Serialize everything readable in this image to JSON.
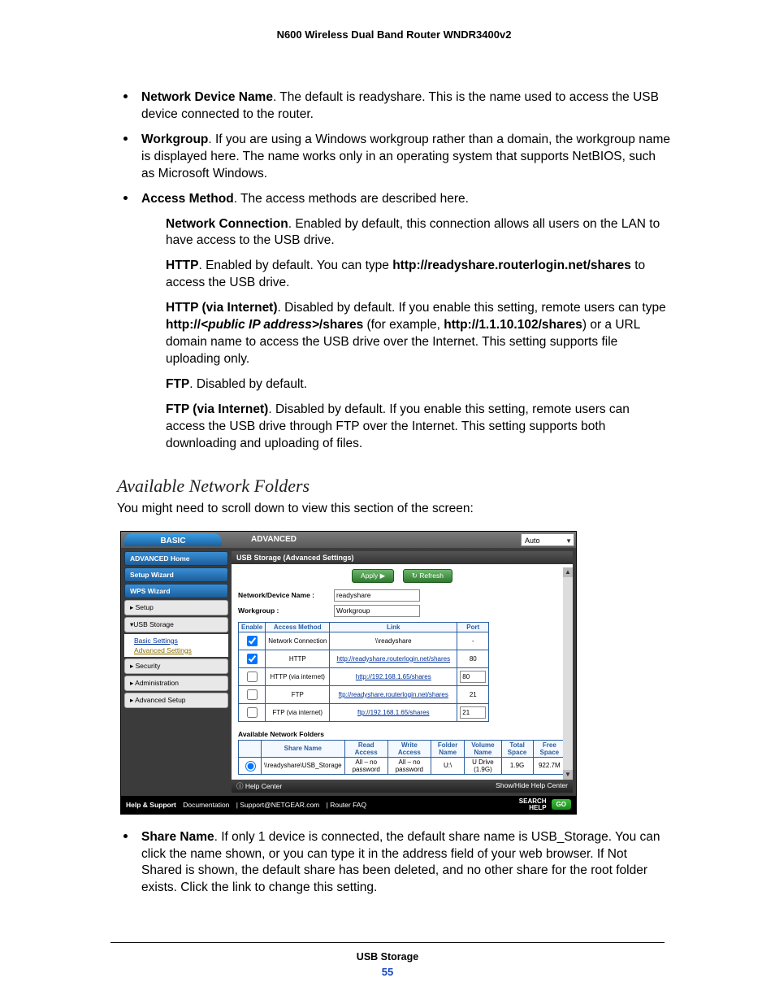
{
  "doc_title": "N600 Wireless Dual Band Router WNDR3400v2",
  "bullets": {
    "ndn": {
      "term": "Network Device Name",
      "text": ". The default is readyshare. This is the name used to access the USB device connected to the router."
    },
    "wg": {
      "term": "Workgroup",
      "text": ". If you are using a Windows workgroup rather than a domain, the workgroup name is displayed here. The name works only in an operating system that supports NetBIOS, such as Microsoft Windows."
    },
    "am": {
      "term": "Access Method",
      "text": ". The access methods are described here."
    }
  },
  "paragraphs": {
    "netconn": {
      "term": "Network Connection",
      "text": ". Enabled by default, this connection allows all users on the LAN to have access to the USB drive."
    },
    "http_pre": {
      "term": "HTTP",
      "text_a": ". Enabled by default. You can type ",
      "url": "http://readyshare.routerlogin.net/shares",
      "text_b": " to access the USB drive."
    },
    "httpi": {
      "term": "HTTP (via Internet)",
      "text_a": ". Disabled by default. If you enable this setting, remote users can type ",
      "url_tpl": "http://<public IP address>/shares",
      "text_b": " (for example, ",
      "url_ex": "http://1.1.10.102/shares",
      "text_c": ") or a URL domain name to access the USB drive over the Internet. This setting supports file uploading only."
    },
    "ftp": {
      "term": "FTP",
      "text": ". Disabled by default."
    },
    "ftpi": {
      "term": "FTP (via Internet)",
      "text": ". Disabled by default. If you enable this setting, remote users can access the USB drive through FTP over the Internet. This setting supports both downloading and uploading of files."
    }
  },
  "section_heading": "Available Network Folders",
  "section_intro": "You might need to scroll down to view this section of the screen:",
  "share_name": {
    "term": "Share Name",
    "text": ". If only 1 device is connected, the default share name is USB_Storage. You can click the name shown, or you can type it in the address field of your web browser. If Not Shared is shown, the default share has been deleted, and no other share for the root folder exists. Click the link to change this setting."
  },
  "figure": {
    "tabs": {
      "basic": "BASIC",
      "advanced": "ADVANCED",
      "auto": "Auto"
    },
    "sidebar": {
      "home": "ADVANCED Home",
      "setup_wiz": "Setup Wizard",
      "wps_wiz": "WPS Wizard",
      "setup": "▸ Setup",
      "usb": "▾USB Storage",
      "sub_basic": "Basic Settings",
      "sub_adv": "Advanced Settings",
      "security": "▸ Security",
      "admin": "▸ Administration",
      "advsetup": "▸ Advanced Setup"
    },
    "main": {
      "header": "USB Storage (Advanced Settings)",
      "apply": "Apply ▶",
      "refresh": "↻ Refresh",
      "ndn_label": "Network/Device Name :",
      "ndn_value": "readyshare",
      "wg_label": "Workgroup :",
      "wg_value": "Workgroup",
      "table": {
        "headers": {
          "enable": "Enable",
          "method": "Access Method",
          "link": "Link",
          "port": "Port"
        },
        "rows": [
          {
            "checked": true,
            "method": "Network Connection",
            "link": "\\\\readyshare",
            "plainlink": true,
            "port": "-",
            "portInput": false
          },
          {
            "checked": true,
            "method": "HTTP",
            "link": "http://readyshare.routerlogin.net/shares",
            "port": "80",
            "portInput": false
          },
          {
            "checked": false,
            "method": "HTTP (via internet)",
            "link": "http://192.168.1.65/shares",
            "port": "80",
            "portInput": true
          },
          {
            "checked": false,
            "method": "FTP",
            "link": "ftp://readyshare.routerlogin.net/shares",
            "port": "21",
            "portInput": false
          },
          {
            "checked": false,
            "method": "FTP (via internet)",
            "link": "ftp://192.168.1.65/shares",
            "port": "21",
            "portInput": true
          }
        ]
      },
      "af_heading": "Available Network Folders",
      "folders": {
        "headers": {
          "sel": "",
          "share": "Share Name",
          "read": "Read Access",
          "write": "Write Access",
          "folder": "Folder Name",
          "volume": "Volume Name",
          "total": "Total Space",
          "free": "Free Space"
        },
        "row": {
          "share": "\\\\readyshare\\USB_Storage",
          "read": "All – no password",
          "write": "All – no password",
          "folder": "U:\\",
          "volume": "U Drive (1.9G)",
          "total": "1.9G",
          "free": "922.7M"
        }
      },
      "helpcenter": "ⓘ Help Center",
      "helpshow": "Show/Hide Help Center"
    },
    "footer": {
      "help": "Help & Support",
      "doc": "Documentation",
      "sup": "Support@NETGEAR.com",
      "faq": "Router FAQ",
      "search1": "SEARCH",
      "search2": "HELP",
      "go": "GO"
    }
  },
  "page_footer": {
    "chapter": "USB Storage",
    "page": "55"
  }
}
